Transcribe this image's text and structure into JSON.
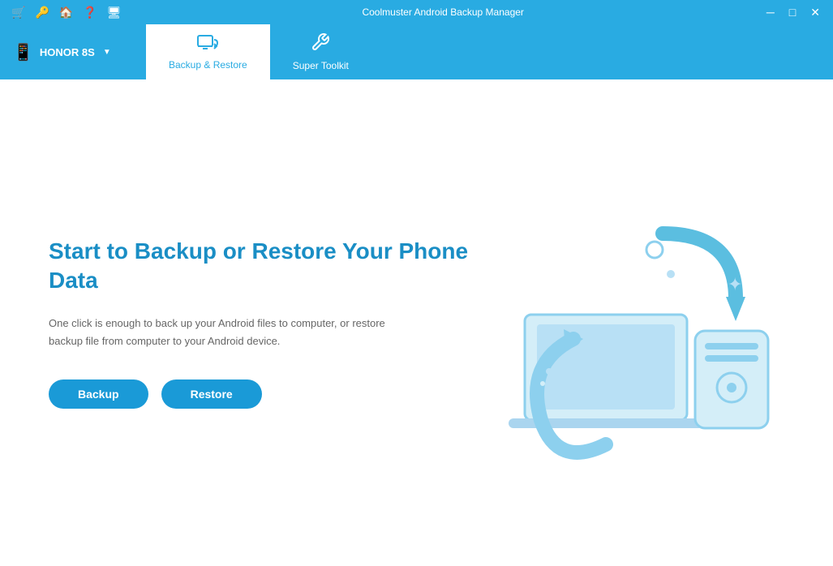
{
  "titlebar": {
    "title": "Coolmuster Android Backup Manager",
    "icons": [
      "cart",
      "key",
      "home",
      "help",
      "monitor"
    ],
    "controls": [
      "minimize",
      "maximize",
      "close"
    ]
  },
  "device": {
    "name": "HONOR 8S",
    "icon": "📱"
  },
  "tabs": [
    {
      "id": "backup-restore",
      "label": "Backup & Restore",
      "active": true
    },
    {
      "id": "super-toolkit",
      "label": "Super Toolkit",
      "active": false
    }
  ],
  "main": {
    "heading": "Start to Backup or Restore Your Phone Data",
    "description": "One click is enough to back up your Android files to computer, or restore backup file from computer to your Android device.",
    "backup_label": "Backup",
    "restore_label": "Restore"
  }
}
